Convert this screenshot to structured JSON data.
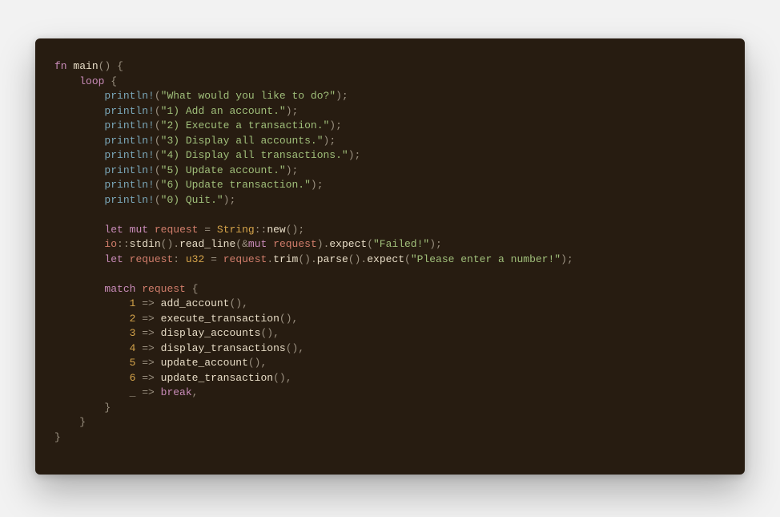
{
  "colors": {
    "background_page": "#f2f2f2",
    "background_code": "#271c11",
    "default_text": "#ccc0ae",
    "keyword": "#c98bb9",
    "macro": "#7aa6b8",
    "string": "#a0bf7a",
    "type": "#d4a34a",
    "path": "#d17d6b",
    "variable": "#d17d6b",
    "number": "#d4a34a",
    "punct": "#9a9080"
  },
  "code": {
    "language": "rust",
    "l1_fn": "fn",
    "l1_main": "main",
    "l1_paren": "()",
    "l1_space": " ",
    "l1_brace": "{",
    "l2_indent": "    ",
    "l2_loop": "loop",
    "l2_space": " ",
    "l2_brace": "{",
    "pln_indent": "        ",
    "pln_macro": "println",
    "pln_bang": "!",
    "pln_open": "(",
    "pln_close": ")",
    "pln_semi": ";",
    "s_prompt": "\"What would you like to do?\"",
    "s_opt1": "\"1) Add an account.\"",
    "s_opt2": "\"2) Execute a transaction.\"",
    "s_opt3": "\"3) Display all accounts.\"",
    "s_opt4": "\"4) Display all transactions.\"",
    "s_opt5": "\"5) Update account.\"",
    "s_opt6": "\"6) Update transaction.\"",
    "s_opt0": "\"0) Quit.\"",
    "blank": "",
    "l12_indent": "        ",
    "l12_let": "let",
    "l12_sp1": " ",
    "l12_mut": "mut",
    "l12_sp2": " ",
    "l12_request": "request",
    "l12_sp3": " ",
    "l12_eq": "=",
    "l12_sp4": " ",
    "l12_string": "String",
    "l12_cc": "::",
    "l12_new": "new",
    "l12_paren": "()",
    "l12_semi": ";",
    "l13_indent": "        ",
    "l13_io": "io",
    "l13_cc": "::",
    "l13_stdin": "stdin",
    "l13_p1": "()",
    "l13_dot1": ".",
    "l13_readline": "read_line",
    "l13_op": "(",
    "l13_amp": "&",
    "l13_mut": "mut",
    "l13_sp": " ",
    "l13_request": "request",
    "l13_cp": ")",
    "l13_dot2": ".",
    "l13_expect": "expect",
    "l13_op2": "(",
    "l13_failed": "\"Failed!\"",
    "l13_cp2": ")",
    "l13_semi": ";",
    "l14_indent": "        ",
    "l14_let": "let",
    "l14_sp1": " ",
    "l14_request": "request",
    "l14_colon": ":",
    "l14_sp2": " ",
    "l14_u32": "u32",
    "l14_sp3": " ",
    "l14_eq": "=",
    "l14_sp4": " ",
    "l14_request2": "request",
    "l14_dot1": ".",
    "l14_trim": "trim",
    "l14_p1": "()",
    "l14_dot2": ".",
    "l14_parse": "parse",
    "l14_p2": "()",
    "l14_dot3": ".",
    "l14_expect": "expect",
    "l14_op": "(",
    "l14_msg": "\"Please enter a number!\"",
    "l14_cp": ")",
    "l14_semi": ";",
    "l16_indent": "        ",
    "l16_match": "match",
    "l16_sp": " ",
    "l16_request": "request",
    "l16_sp2": " ",
    "l16_brace": "{",
    "arm_indent": "            ",
    "arm_arrow": " => ",
    "arm_paren": "()",
    "arm_comma": ",",
    "n1": "1",
    "f1": "add_account",
    "n2": "2",
    "f2": "execute_transaction",
    "n3": "3",
    "f3": "display_accounts",
    "n4": "4",
    "f4": "display_transactions",
    "n5": "5",
    "f5": "update_account",
    "n6": "6",
    "f6": "update_transaction",
    "und": "_",
    "brk": "break",
    "close3_indent": "        ",
    "close3": "}",
    "close2_indent": "    ",
    "close2": "}",
    "close1": "}"
  }
}
